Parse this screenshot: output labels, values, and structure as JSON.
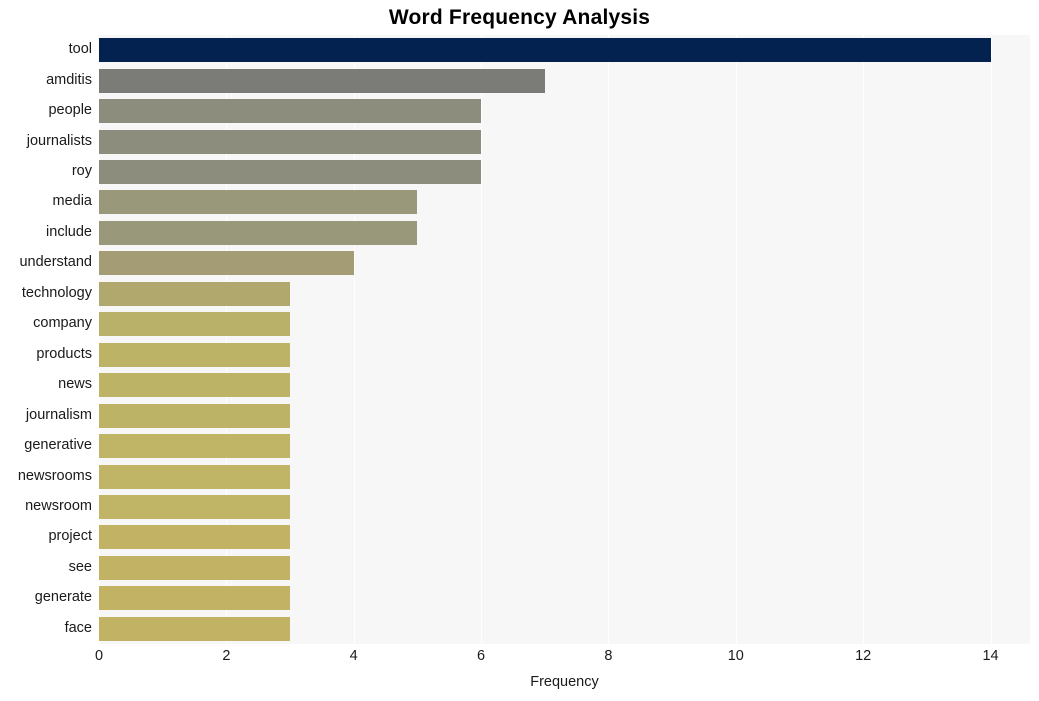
{
  "chart_data": {
    "type": "bar",
    "orientation": "horizontal",
    "title": "Word Frequency Analysis",
    "xlabel": "Frequency",
    "ylabel": "",
    "categories": [
      "tool",
      "amditis",
      "people",
      "journalists",
      "roy",
      "media",
      "include",
      "understand",
      "technology",
      "company",
      "products",
      "news",
      "journalism",
      "generative",
      "newsrooms",
      "newsroom",
      "project",
      "see",
      "generate",
      "face"
    ],
    "values": [
      14,
      7,
      6,
      6,
      6,
      5,
      5,
      4,
      3,
      3,
      3,
      3,
      3,
      3,
      3,
      3,
      3,
      3,
      3,
      3
    ],
    "bar_colors": [
      "#04224f",
      "#7b7b78",
      "#8d8d7e",
      "#8d8d7e",
      "#8d8d7e",
      "#9a987b",
      "#9a987b",
      "#a39c74",
      "#b0a86c",
      "#b9b069",
      "#bdb367",
      "#bdb367",
      "#bdb367",
      "#c0b566",
      "#c0b566",
      "#c0b566",
      "#c2b264",
      "#c2b264",
      "#c2b264",
      "#c2b264"
    ],
    "xticks": [
      0,
      2,
      4,
      6,
      8,
      10,
      12,
      14
    ],
    "xticklabels": [
      "0",
      "2",
      "4",
      "6",
      "8",
      "10",
      "12",
      "14"
    ],
    "xlim": [
      0,
      14.62
    ],
    "grid": true,
    "grid_axis": "x",
    "grid_color": "#ffffff",
    "plot_background": "#f7f7f7",
    "figure_background": "#ffffff",
    "legend": null
  }
}
